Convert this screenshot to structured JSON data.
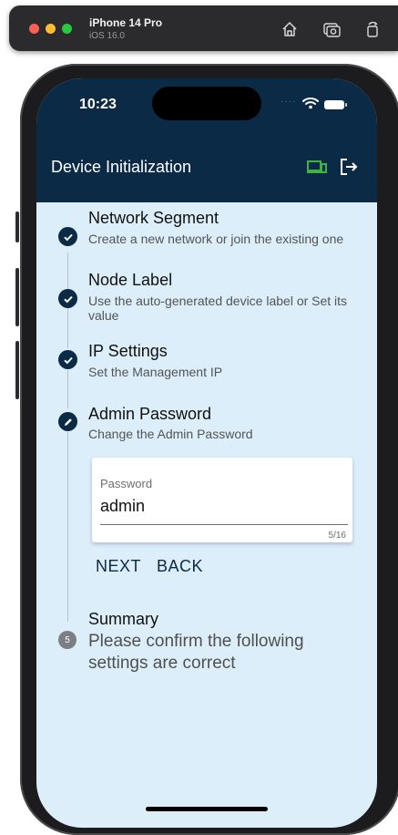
{
  "simulator": {
    "device_name": "iPhone 14 Pro",
    "os_version": "iOS 16.0"
  },
  "status_bar": {
    "time": "10:23"
  },
  "app": {
    "title": "Device Initialization",
    "accent_color": "#43b244",
    "header_color": "#0b2a45",
    "background_color": "#ddeefb"
  },
  "steps": [
    {
      "title": "Network Segment",
      "subtitle": "Create a new network or join the existing one",
      "state": "complete"
    },
    {
      "title": "Node Label",
      "subtitle": "Use the auto-generated device label or Set its value",
      "state": "complete"
    },
    {
      "title": "IP Settings",
      "subtitle": "Set the Management IP",
      "state": "complete"
    },
    {
      "title": "Admin Password",
      "subtitle": "Change the Admin Password",
      "state": "editing"
    },
    {
      "title": "Summary",
      "subtitle": "Please confirm the following settings are correct",
      "state": "pending",
      "number": "5"
    }
  ],
  "password_field": {
    "label": "Password",
    "value": "admin",
    "counter": "5/16"
  },
  "actions": {
    "next_label": "NEXT",
    "back_label": "BACK"
  }
}
